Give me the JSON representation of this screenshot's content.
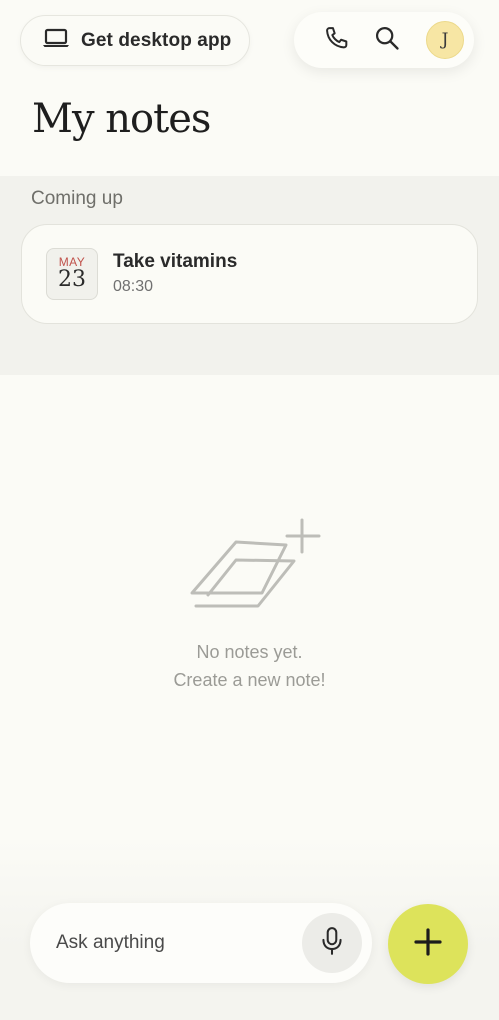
{
  "header": {
    "desktop_app_label": "Get desktop app",
    "avatar_initial": "J",
    "icons": [
      "laptop-icon",
      "phone-icon",
      "search-icon"
    ]
  },
  "page_title": "My notes",
  "coming_up": {
    "label": "Coming up",
    "events": [
      {
        "month": "MAY",
        "day": "23",
        "title": "Take vitamins",
        "time": "08:30"
      }
    ]
  },
  "empty_state": {
    "line1": "No notes yet.",
    "line2": "Create a new note!",
    "icon": "empty-notes-icon"
  },
  "bottom_bar": {
    "ask_placeholder": "Ask anything",
    "icons": [
      "microphone-icon",
      "plus-icon"
    ]
  },
  "colors": {
    "background": "#fbfbf6",
    "section_background": "#f2f2ed",
    "avatar": "#f7e6a4",
    "fab": "#dde35b",
    "month_accent": "#c0524b"
  }
}
